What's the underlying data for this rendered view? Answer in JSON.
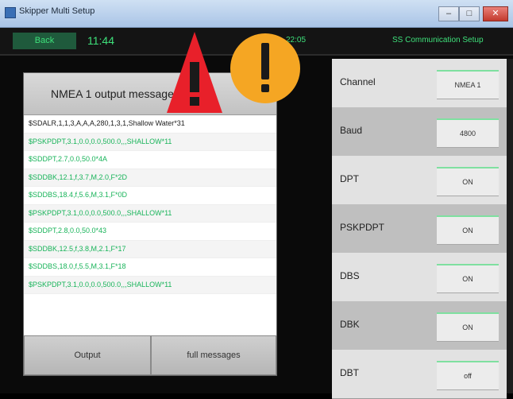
{
  "window": {
    "title": "Skipper Multi Setup",
    "minimize_label": "–",
    "maximize_label": "□",
    "close_label": "✕"
  },
  "status_bar": {
    "back_label": "Back",
    "time": "11:44",
    "datetime": "22:05",
    "status_message": "SS Communication Setup"
  },
  "output_panel": {
    "title": "NMEA 1 output messages",
    "messages": [
      {
        "text": "$SDALR,1,1,3,A,A,A,280,1,3,1,Shallow Water*31",
        "color": "black"
      },
      {
        "text": "$PSKPDPT,3.1,0.0,0.0,500.0,,,SHALLOW*11",
        "color": "green"
      },
      {
        "text": "$SDDPT,2.7,0.0,50.0*4A",
        "color": "green"
      },
      {
        "text": "$SDDBK,12.1,f,3.7,M,2.0,F*2D",
        "color": "green"
      },
      {
        "text": "$SDDBS,18.4,f,5.6,M,3.1,F*0D",
        "color": "green"
      },
      {
        "text": "$PSKPDPT,3.1,0.0,0.0,500.0,,,SHALLOW*11",
        "color": "green"
      },
      {
        "text": "$SDDPT,2.8,0.0,50.0*43",
        "color": "green"
      },
      {
        "text": "$SDDBK,12.5,f,3.8,M,2.1,F*17",
        "color": "green"
      },
      {
        "text": "$SDDBS,18.0,f,5.5,M,3.1,F*18",
        "color": "green"
      },
      {
        "text": "$PSKPDPT,3.1,0.0,0.0,500.0,,,SHALLOW*11",
        "color": "green"
      }
    ],
    "output_button": "Output",
    "full_messages_button": "full messages"
  },
  "settings": [
    {
      "label": "Channel",
      "value": "NMEA 1"
    },
    {
      "label": "Baud",
      "value": "4800"
    },
    {
      "label": "DPT",
      "value": "ON"
    },
    {
      "label": "PSKPDPT",
      "value": "ON"
    },
    {
      "label": "DBS",
      "value": "ON"
    },
    {
      "label": "DBK",
      "value": "ON"
    },
    {
      "label": "DBT",
      "value": "off"
    }
  ],
  "colors": {
    "accent_green": "#3ee07a",
    "warning_red": "#e8202a",
    "alert_orange": "#f5a623"
  },
  "icons": {
    "warning": "warning-triangle-icon",
    "alert": "alert-circle-icon"
  }
}
